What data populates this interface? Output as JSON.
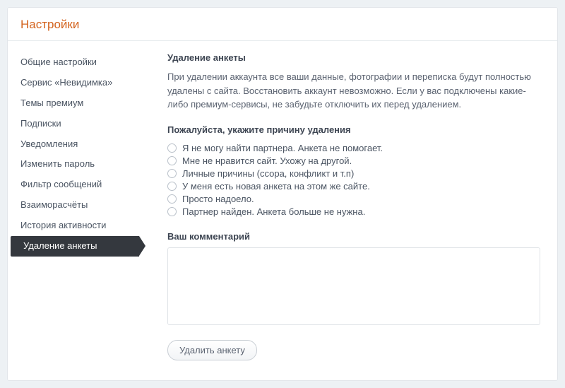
{
  "header": {
    "title": "Настройки"
  },
  "sidebar": {
    "items": [
      {
        "label": "Общие настройки",
        "active": false
      },
      {
        "label": "Сервис «Невидимка»",
        "active": false
      },
      {
        "label": "Темы премиум",
        "active": false
      },
      {
        "label": "Подписки",
        "active": false
      },
      {
        "label": "Уведомления",
        "active": false
      },
      {
        "label": "Изменить пароль",
        "active": false
      },
      {
        "label": "Фильтр сообщений",
        "active": false
      },
      {
        "label": "Взаиморасчёты",
        "active": false
      },
      {
        "label": "История активности",
        "active": false
      },
      {
        "label": "Удаление анкеты",
        "active": true
      }
    ]
  },
  "main": {
    "section_title": "Удаление анкеты",
    "intro": "При удалении аккаунта все ваши данные, фотографии и переписка будут полностью удалены с сайта. Восстановить аккаунт невозможно. Если у вас подключены какие-либо премиум-сервисы, не забудьте отключить их перед удалением.",
    "reason_heading": "Пожалуйста, укажите причину удаления",
    "reasons": [
      {
        "label": "Я не могу найти партнера. Анкета не помогает."
      },
      {
        "label": "Мне не нравится сайт. Ухожу на другой."
      },
      {
        "label": "Личные причины (ссора, конфликт и т.п)"
      },
      {
        "label": "У меня есть новая анкета на этом же сайте."
      },
      {
        "label": "Просто надоело."
      },
      {
        "label": "Партнер найден. Анкета больше не нужна."
      }
    ],
    "comment_label": "Ваш комментарий",
    "comment_value": "",
    "submit_label": "Удалить анкету"
  }
}
